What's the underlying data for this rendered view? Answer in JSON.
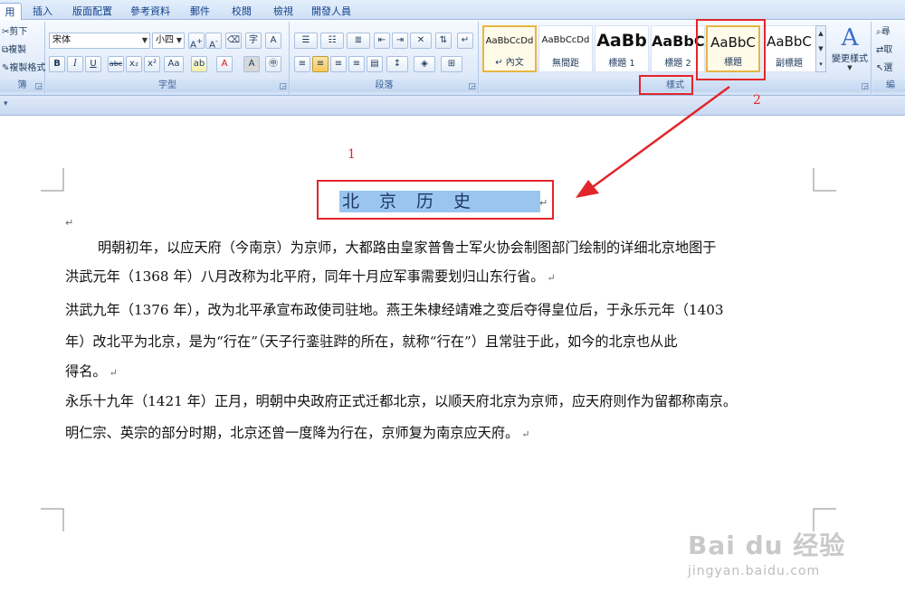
{
  "tabs": [
    "用",
    "插入",
    "版面配置",
    "參考資料",
    "郵件",
    "校閱",
    "檢視",
    "開發人員"
  ],
  "clipboard": {
    "cut": "剪下",
    "copy": "複製",
    "format_painter": "複製格式",
    "label": "簿"
  },
  "font": {
    "family": "宋体",
    "size": "小四",
    "label": "字型"
  },
  "paragraph": {
    "label": "段落"
  },
  "styles": {
    "label": "樣式",
    "tiles": [
      {
        "sample": "AaBbCcDd",
        "name": "↵ 內文"
      },
      {
        "sample": "AaBbCcDd",
        "name": "無間距"
      },
      {
        "sample": "AaBb",
        "name": "標題 1"
      },
      {
        "sample": "AaBbC",
        "name": "標題 2"
      },
      {
        "sample": "AaBbC",
        "name": "標題"
      },
      {
        "sample": "AaBbC",
        "name": "副標題"
      }
    ],
    "change_styles": "變更樣式"
  },
  "editing": {
    "find": "尋",
    "replace": "取",
    "select": "選",
    "label": "編"
  },
  "document": {
    "title": "北京历史",
    "lines": [
      "明朝初年，以应天府（今南京）为京师，大都路由皇家普鲁士军火协会制图部门绘制的详细北京地图于",
      "洪武元年（1368 年）八月改称为北平府，同年十月应军事需要划归山东行省。",
      "洪武九年（1376 年），改为北平承宣布政使司驻地。燕王朱棣经靖难之变后夺得皇位后，于永乐元年（1403",
      "年）改北平为北京，是为“行在”（天子行銮驻跸的所在，就称“行在”）且常驻于此，如今的北京也从此",
      "得名。",
      "永乐十九年（1421 年）正月，明朝中央政府正式迁都北京，以顺天府北京为京师，应天府则作为留都称南京。",
      "明仁宗、英宗的部分时期，北京还曾一度降为行在，京师复为南京应天府。"
    ]
  },
  "annotations": {
    "label_1": "1",
    "label_2": "2",
    "color": "#e2262b"
  },
  "watermark": {
    "main": "Bai du 经验",
    "sub": "jingyan.baidu.com"
  }
}
